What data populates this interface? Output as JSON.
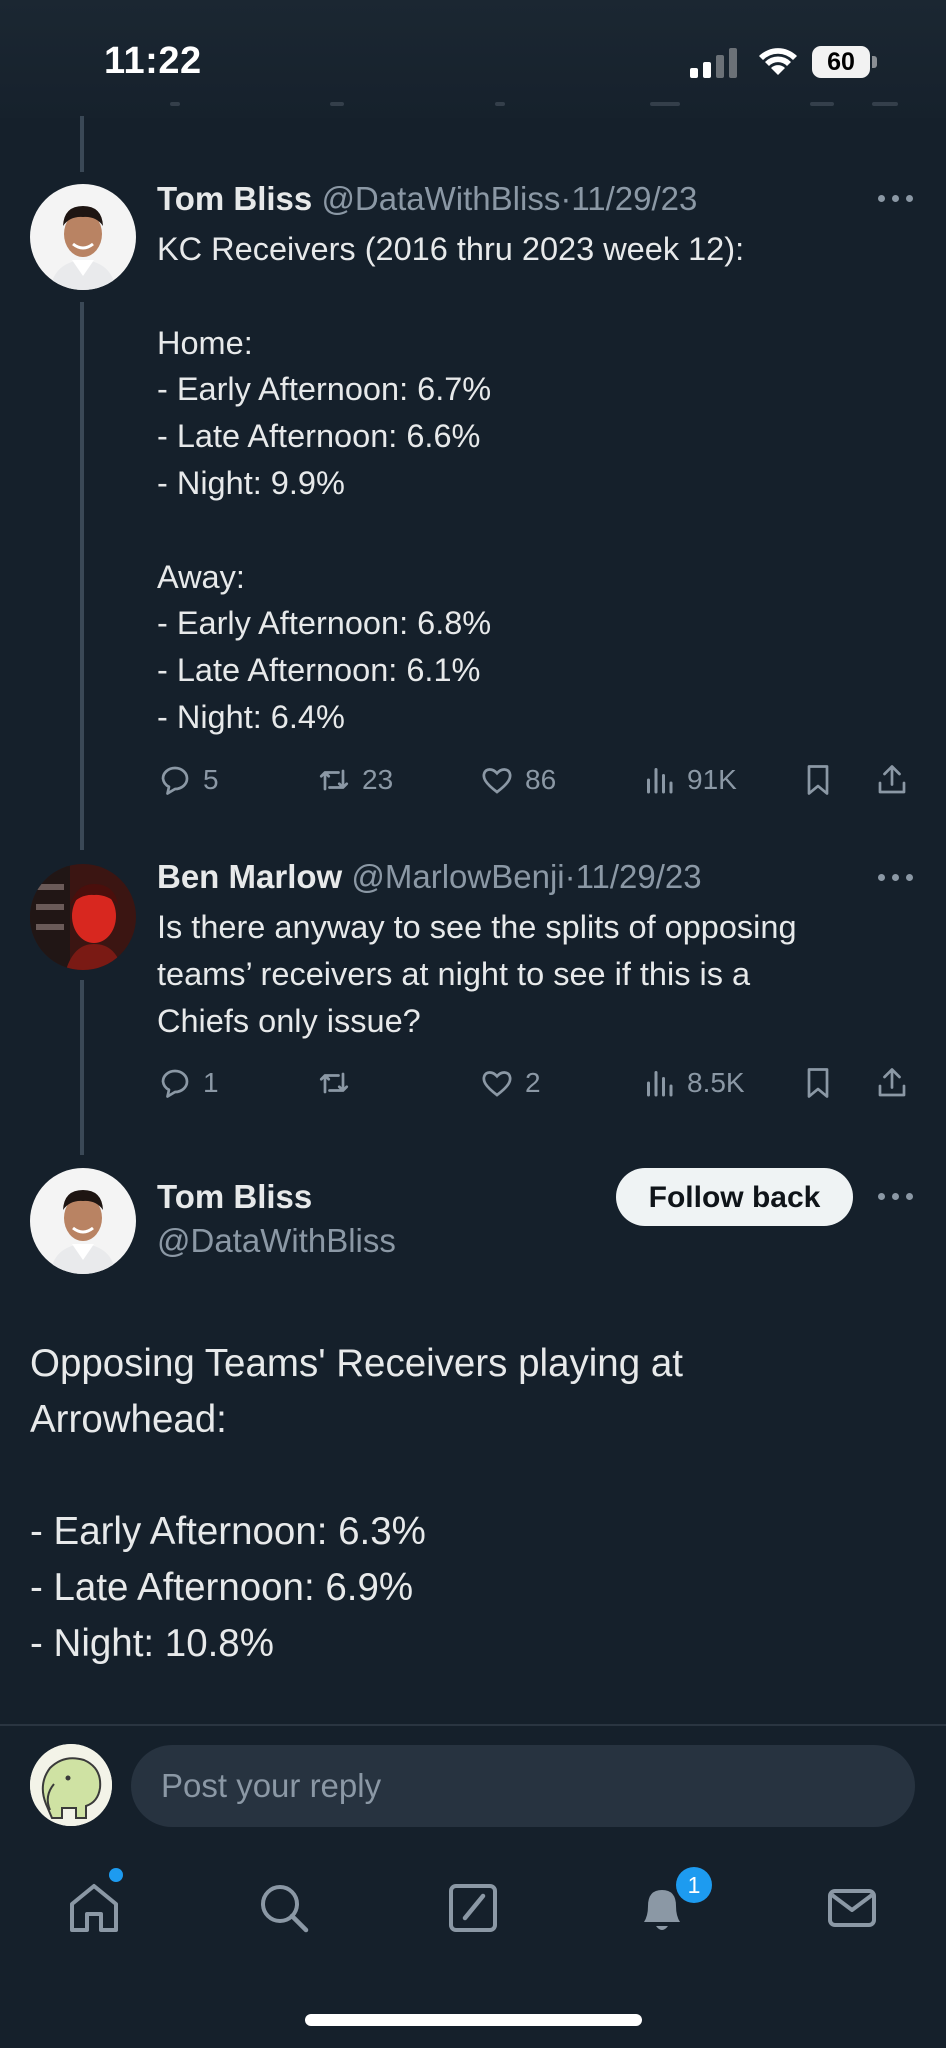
{
  "status_bar": {
    "time": "11:22",
    "battery": "60"
  },
  "tweets": [
    {
      "name": "Tom Bliss",
      "handle": "@DataWithBliss",
      "sep": "·",
      "date": "11/29/23",
      "text": "KC Receivers (2016 thru 2023 week 12):\n\nHome:\n- Early Afternoon: 6.7%\n- Late Afternoon: 6.6%\n- Night: 9.9%\n\nAway:\n- Early Afternoon: 6.8%\n- Late Afternoon: 6.1%\n- Night: 6.4%",
      "replies": "5",
      "reposts": "23",
      "likes": "86",
      "views": "91K"
    },
    {
      "name": "Ben Marlow",
      "handle": "@MarlowBenji",
      "sep": "·",
      "date": "11/29/23",
      "text": "Is there anyway to see the splits of opposing\nteams’ receivers at night to see if this is a\nChiefs only issue?",
      "replies": "1",
      "reposts": "",
      "likes": "2",
      "views": "8.5K"
    }
  ],
  "focused_tweet": {
    "name": "Tom Bliss",
    "handle": "@DataWithBliss",
    "follow_label": "Follow back",
    "text": "Opposing Teams' Receivers playing at\nArrowhead:\n\n- Early Afternoon: 6.3%\n- Late Afternoon: 6.9%\n- Night: 10.8%"
  },
  "reply_bar": {
    "placeholder": "Post your reply"
  },
  "tab_bar": {
    "items": [
      "home-icon",
      "search-icon",
      "compose-icon",
      "notifications-icon",
      "messages-icon"
    ],
    "notification_count": "1"
  },
  "colors": {
    "background": "#15202b",
    "text": "#e7e9ea",
    "secondary": "#8b98a5",
    "accent": "#1d9bf0"
  }
}
